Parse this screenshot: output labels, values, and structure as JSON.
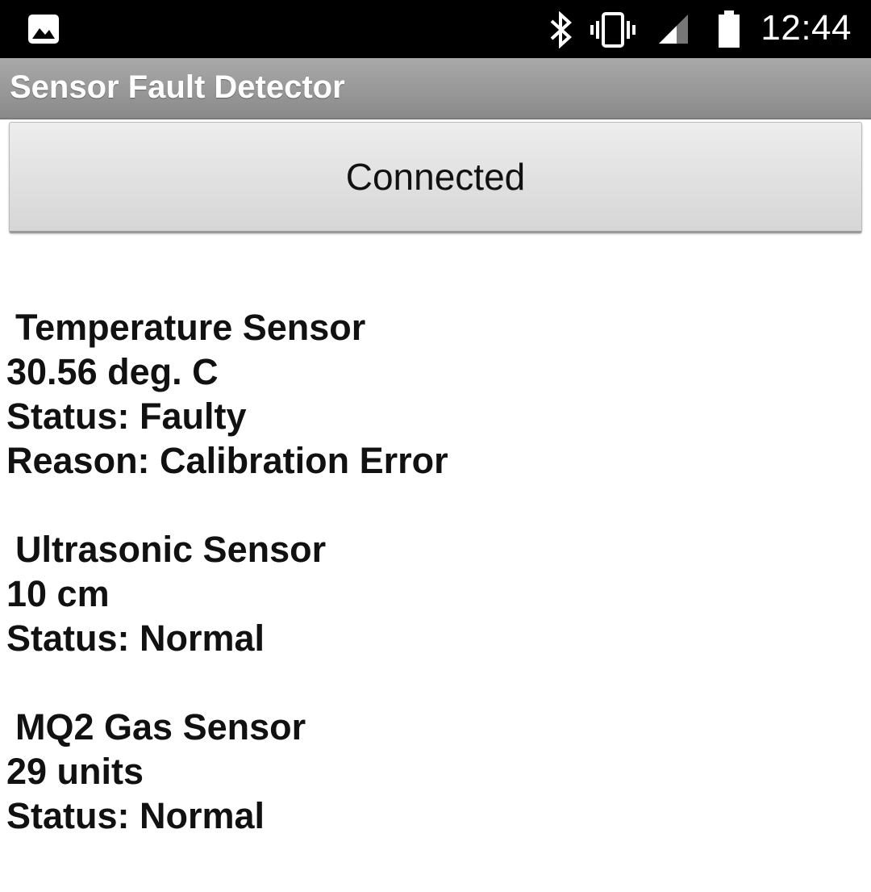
{
  "status_bar": {
    "time": "12:44",
    "icons": [
      "gallery-icon",
      "bluetooth-icon",
      "vibrate-icon",
      "signal-icon",
      "battery-icon"
    ]
  },
  "app": {
    "title": "Sensor Fault Detector"
  },
  "connection_button": {
    "label": "Connected"
  },
  "sensors": [
    {
      "name": "Temperature Sensor",
      "value": "30.56 deg. C",
      "status": "Status: Faulty",
      "reason": "Reason: Calibration Error"
    },
    {
      "name": "Ultrasonic Sensor",
      "value": "10 cm",
      "status": "Status: Normal"
    },
    {
      "name": "MQ2 Gas Sensor",
      "value": "29 units",
      "status": "Status: Normal"
    }
  ],
  "colors": {
    "status_bar_bg": "#000000",
    "title_bar_bg": "#999999",
    "button_bg": "#e2e2e2",
    "text": "#111111"
  }
}
